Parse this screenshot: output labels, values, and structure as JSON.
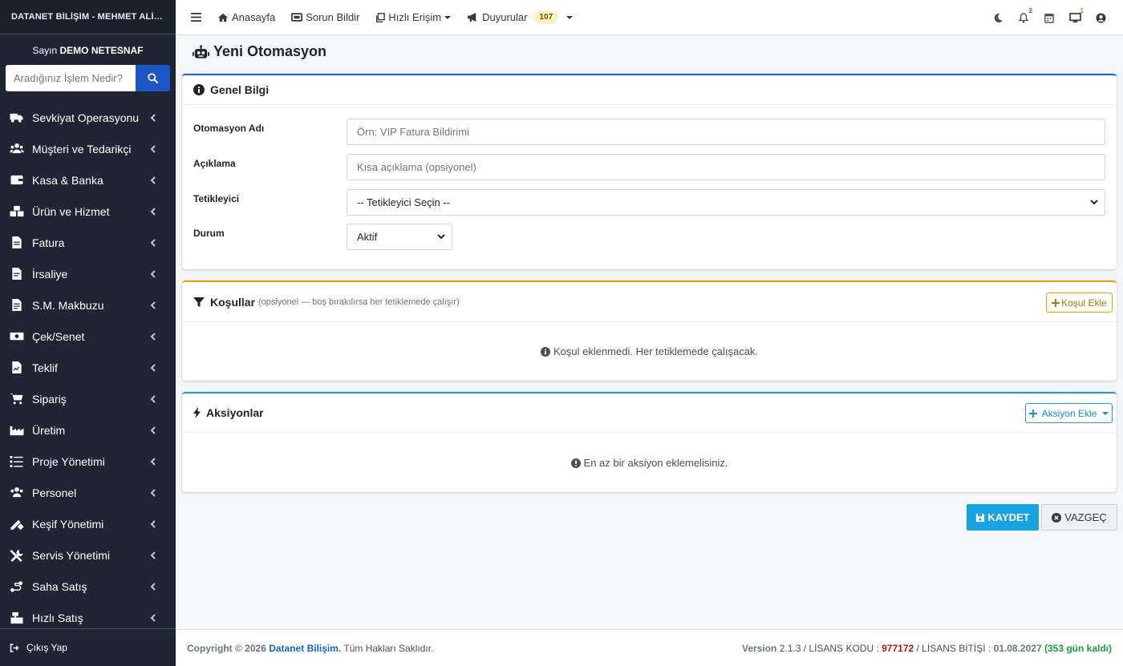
{
  "sidebar": {
    "brand": "DATANET BİLİŞİM - MEHMET ALİ ÇAKIR",
    "greeting_prefix": "Sayın",
    "user_name": "DEMO NETESNAF",
    "search_placeholder": "Aradığınız İşlem Nedir?",
    "items": [
      {
        "label": "Sevkiyat Operasyonu",
        "icon": "truck-icon"
      },
      {
        "label": "Müşteri ve Tedarikçi",
        "icon": "users-icon"
      },
      {
        "label": "Kasa & Banka",
        "icon": "wallet-icon"
      },
      {
        "label": "Ürün ve Hizmet",
        "icon": "boxes-icon"
      },
      {
        "label": "Fatura",
        "icon": "invoice-icon"
      },
      {
        "label": "İrsaliye",
        "icon": "file-icon"
      },
      {
        "label": "S.M. Makbuzu",
        "icon": "receipt-icon"
      },
      {
        "label": "Çek/Senet",
        "icon": "money-bill-icon"
      },
      {
        "label": "Teklif",
        "icon": "file-signature-icon"
      },
      {
        "label": "Sipariş",
        "icon": "cart-icon"
      },
      {
        "label": "Üretim",
        "icon": "industry-icon"
      },
      {
        "label": "Proje Yönetimi",
        "icon": "tasks-icon"
      },
      {
        "label": "Personel",
        "icon": "users-cog-icon"
      },
      {
        "label": "Keşif Yönetimi",
        "icon": "ruler-pencil-icon"
      },
      {
        "label": "Servis Yönetimi",
        "icon": "tools-icon"
      },
      {
        "label": "Saha Satış",
        "icon": "route-icon"
      },
      {
        "label": "Hızlı Satış",
        "icon": "cash-register-icon"
      }
    ],
    "logout_label": "Çıkış Yap"
  },
  "topbar": {
    "home": "Anasayfa",
    "report": "Sorun Bildir",
    "quick": "Hızlı Erişim",
    "announcements": "Duyurular",
    "announcements_count": "107",
    "notifications_count": "2",
    "monitor_count": "1"
  },
  "page": {
    "title": "Yeni Otomasyon"
  },
  "general": {
    "title": "Genel Bilgi",
    "name_label": "Otomasyon Adı",
    "name_placeholder": "Örn: VIP Fatura Bildirimi",
    "desc_label": "Açıklama",
    "desc_placeholder": "Kısa açıklama (opsiyonel)",
    "trigger_label": "Tetikleyici",
    "trigger_value": "-- Tetikleyici Seçin --",
    "status_label": "Durum",
    "status_value": "Aktif"
  },
  "conditions": {
    "title": "Koşullar",
    "subtitle": "(opsiyonel — boş bırakılırsa her tetiklemede çalışır)",
    "add_button": "Koşul Ekle",
    "empty": "Koşul eklenmedi. Her tetiklemede çalışacak."
  },
  "actions": {
    "title": "Aksiyonlar",
    "add_button": "Aksiyon Ekle",
    "empty": "En az bir aksiyon eklemelisiniz."
  },
  "buttons": {
    "save": "KAYDET",
    "cancel": "VAZGEÇ"
  },
  "footer": {
    "copyright": "Copyright © 2026",
    "company": "Datanet Bilişim.",
    "rights": "Tüm Hakları Saklıdır.",
    "version_label": "Version",
    "version": "2.1.3",
    "license_label": "/ LİSANS KODU :",
    "license_code": "977172",
    "expiry_label": "/ LİSANS BİTİŞİ :",
    "expiry_date": "01.08.2027",
    "remaining": "(353 gün kaldı)"
  },
  "colors": {
    "sidebar_bg": "#1f2533",
    "primary": "#1466c8",
    "warning": "#e2a300",
    "info": "#1a9ed8",
    "save": "#17a2e0"
  }
}
